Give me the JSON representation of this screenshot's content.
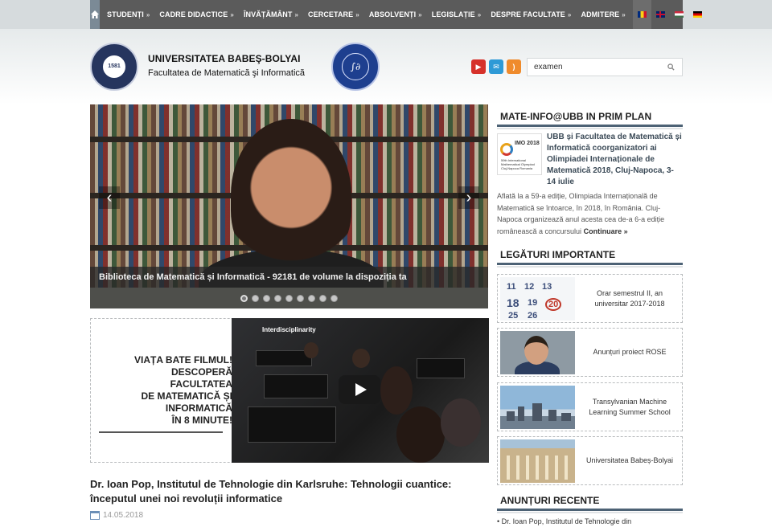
{
  "nav": {
    "items": [
      {
        "label": "STUDENȚI",
        "arrow": "»"
      },
      {
        "label": "CADRE DIDACTICE",
        "arrow": "»"
      },
      {
        "label": "ÎNVĂȚĂMÂNT",
        "arrow": "»"
      },
      {
        "label": "CERCETARE",
        "arrow": "»"
      },
      {
        "label": "ABSOLVENȚI",
        "arrow": "»"
      },
      {
        "label": "LEGISLAȚIE",
        "arrow": "»"
      },
      {
        "label": "DESPRE FACULTATE",
        "arrow": "»"
      },
      {
        "label": "ADMITERE",
        "arrow": "»"
      }
    ],
    "languages": [
      "ro",
      "en",
      "hu",
      "de"
    ]
  },
  "header": {
    "university": "UNIVERSITATEA BABEŞ-BOLYAI",
    "faculty": "Facultatea de Matematică şi Informatică",
    "logo1_text": "1581",
    "logo2_text": "∫∂"
  },
  "social": [
    "youtube-icon",
    "mail-icon",
    "rss-icon"
  ],
  "search": {
    "value": "examen",
    "placeholder": "examen"
  },
  "slider": {
    "caption": "Biblioteca de Matematică și Informatică - 92181 de volume la dispoziția ta",
    "prev": "‹",
    "next": "›",
    "dot_count": 9,
    "active_dot": 0
  },
  "film": {
    "line1": "VIAȚA BATE FILMUL!",
    "line2": "DESCOPERĂ",
    "line3": "FACULTATEA",
    "line4": "DE MATEMATICĂ ȘI",
    "line5": "INFORMATICĂ",
    "line6": "ÎN 8 MINUTE!",
    "video_title": "Interdisciplinarity"
  },
  "article": {
    "title": "Dr. Ioan Pop, Institutul de Tehnologie din Karlsruhe: Tehnologii cuantice: începutul unei noi revoluții informatice",
    "date": "14.05.2018"
  },
  "sidebar": {
    "prim_plan_heading": "MATE-INFO@UBB IN PRIM PLAN",
    "news": {
      "thumb_title": "IMO 2018",
      "thumb_caption": "59th International Mathematical Olympiad Cluj-Napoca Romania",
      "title": "UBB și Facultatea de Matematică și Informatică coorganizatori ai Olimpiadei Internaționale de Matematică 2018, Cluj-Napoca, 3-14 iulie",
      "body": "Aflată la a 59-a ediție, Olimpiada Internațională de Matematică se întoarce, în 2018, în România. Cluj-Napoca organizează anul acesta cea de-a 6-a ediție românească a concursului",
      "more": "Continuare »"
    },
    "links_heading": "LEGĂTURI IMPORTANTE",
    "links": [
      {
        "label": "Orar semestrul II, an universitar 2017-2018"
      },
      {
        "label": "Anunțuri proiect ROSE"
      },
      {
        "label": "Transylvanian Machine Learning Summer School"
      },
      {
        "label": "Universitatea Babeș-Bolyai"
      }
    ],
    "calendar_numbers": [
      "11",
      "12",
      "13",
      "18",
      "19",
      "20",
      "25",
      "26"
    ],
    "announcements_heading": "ANUNȚURI RECENTE",
    "announcement_first": "Dr. Ioan Pop, Institutul de Tehnologie din"
  },
  "colors": {
    "nav_bg": "#5b5b5b",
    "heading_rule": "#4d6275",
    "news_title": "#3b4a57"
  }
}
